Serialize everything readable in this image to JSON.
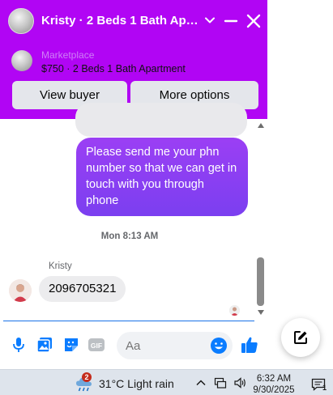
{
  "header": {
    "title": "Kristy · 2 Beds 1 Bath Apar…",
    "marketplace_label": "Marketplace",
    "listing_title": "$750 · 2 Beds 1 Bath Apartment",
    "view_buyer_label": "View buyer",
    "more_options_label": "More options",
    "accent_color": "#b105f4"
  },
  "messages": {
    "outgoing_text": "Please send me your phn number so that we can get in touch with you through phone",
    "timestamp": "Mon 8:13 AM",
    "sender_name": "Kristy",
    "incoming_text": "2096705321"
  },
  "composer": {
    "placeholder": "Aa",
    "icons": [
      "microphone-icon",
      "photo-icon",
      "sticker-icon",
      "gif-icon",
      "emoji-icon",
      "thumbs-up-icon"
    ]
  },
  "taskbar": {
    "weather_badge": "2",
    "weather_text": "31°C  Light rain",
    "time": "6:32 AM",
    "date": "9/30/2025",
    "notification_count": "1"
  }
}
